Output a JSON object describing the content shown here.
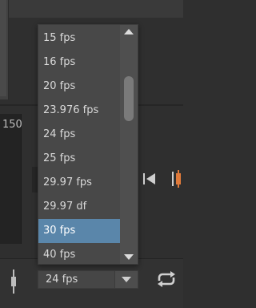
{
  "timeline": {
    "frame_label": "150"
  },
  "framerate_select": {
    "value": "24 fps"
  },
  "dropdown": {
    "options": [
      "15 fps",
      "16 fps",
      "20 fps",
      "23.976 fps",
      "24 fps",
      "25 fps",
      "29.97 fps",
      "29.97 df",
      "30 fps",
      "40 fps"
    ],
    "selected": "30 fps"
  },
  "icons": {
    "prev": "skip-to-start-icon",
    "playhead": "playhead-marker-icon",
    "handle": "drag-handle-icon",
    "loop": "loop-icon",
    "scroll_up": "scroll-up-arrow-icon",
    "scroll_down": "scroll-down-arrow-icon",
    "select_arrow": "chevron-down-icon"
  },
  "colors": {
    "selection": "#5a86aa",
    "playhead_accent": "#e07a3a"
  }
}
